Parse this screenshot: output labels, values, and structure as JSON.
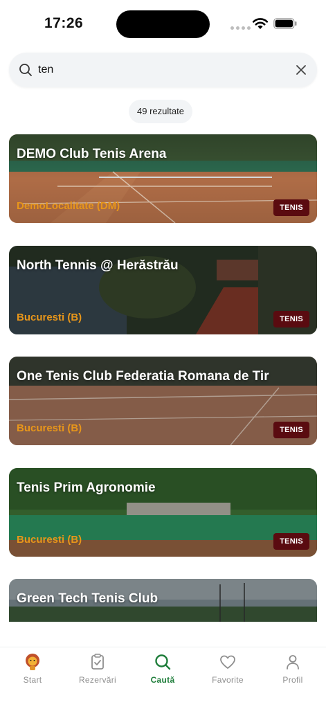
{
  "status_bar": {
    "time": "17:26"
  },
  "search": {
    "value": "ten",
    "placeholder": ""
  },
  "results": {
    "count_label": "49 rezultate"
  },
  "clubs": [
    {
      "name": "DEMO Club Tenis Arena",
      "location": "DemoLocalitate (DM)",
      "tag": "TENIS"
    },
    {
      "name": "North Tennis @ Herăstrău",
      "location": "Bucuresti (B)",
      "tag": "TENIS"
    },
    {
      "name": "One Tenis Club Federatia Romana de Tir",
      "location": "Bucuresti (B)",
      "tag": "TENIS"
    },
    {
      "name": "Tenis Prim Agronomie",
      "location": "Bucuresti (B)",
      "tag": "TENIS"
    },
    {
      "name": "Green Tech Tenis Club"
    }
  ],
  "nav": {
    "start": "Start",
    "reservations": "Rezervări",
    "search": "Caută",
    "favorites": "Favorite",
    "profile": "Profil"
  },
  "colors": {
    "accent_green": "#1e7d3a",
    "location_orange": "#e8961a",
    "tag_maroon": "#5a0b10"
  }
}
